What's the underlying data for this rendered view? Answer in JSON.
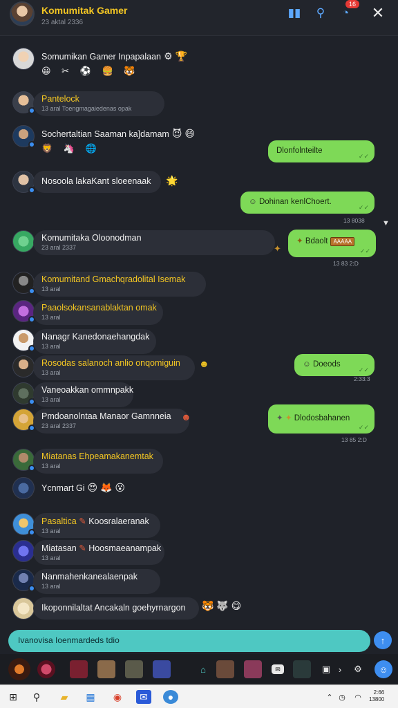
{
  "header": {
    "title": "Komumitak Gamer",
    "subtitle": "23 aktal 2336",
    "badge": "16"
  },
  "icons": {
    "layout": "▮▮",
    "search": "⚲",
    "history": "◔",
    "close": "✕"
  },
  "chats": [
    {
      "name": "Somumikan Gamer Inpapalaan",
      "emoji": "⚙ 🏆",
      "stickers": "😀 ✂ ⚽ 🍔 🐯"
    },
    {
      "name": "Pantelock",
      "meta": "13 aral Toengmagaiedenas opak"
    },
    {
      "name": "Sochertaltian Saaman ka]damam",
      "emoji": "😈 😄",
      "stickers": "🦁 🦄 🌐"
    },
    {
      "name": "Nosoola lakaKant sloeenaak",
      "emoji": "🌟"
    },
    {
      "name": "Komumitaka Oloonodman",
      "meta": "23 aral 2337"
    },
    {
      "name": "Komumitand Gmachqradolital Isemak",
      "meta": "13 aral"
    },
    {
      "name": "Paaolsokansanablaktan omak",
      "meta": "13 aral"
    },
    {
      "name": "Nanagr Kanedonaehangdak",
      "meta": "13 aral"
    },
    {
      "name": "Rosodas salanoch anlio onqomiguin",
      "meta": "13 aral",
      "emoji": "☻"
    },
    {
      "name": "Vaneoakkan ommnpakk",
      "meta": "13 aral"
    },
    {
      "name": "Pmdoanolntaa Manaor Gamnneia",
      "meta": "23 aral 2337",
      "emoji": "☻"
    },
    {
      "name": "Miatanas Ehpeamakanemtak",
      "meta": "13 aral"
    },
    {
      "name": "Ycnmart Gi",
      "emoji": "😍 🦊 😮"
    },
    {
      "name": "Pasaltica",
      "extra": "Koosralaeranak",
      "meta": "13 aral"
    },
    {
      "name": "Miatasan",
      "extra": "Hoosmaeanampak",
      "meta": "13 aral"
    },
    {
      "name": "Nanmahenkanealaenpak",
      "meta": "13 aral"
    },
    {
      "name": "Ikoponnilaltat Ancakaln goehyrnargon",
      "emoji": "🐯 🐺 😋"
    }
  ],
  "outgoing": [
    {
      "text": "Dlonfolnteilte",
      "stamp": ""
    },
    {
      "text": "Dohinan kenlChoert.",
      "stamp": "13 8038"
    },
    {
      "text": "Bdaolt",
      "tag": "AAAAA",
      "stamp": "13 83 2:D"
    },
    {
      "text": "Doeods",
      "stamp": "2:33:3"
    },
    {
      "text": "Dlodosbahanen",
      "stamp": "13 85 2:D"
    }
  ],
  "composer": {
    "placeholder": "Ivanovisa Ioenmardeds tdio"
  },
  "clock": {
    "line1": "2:66",
    "line2": "13800"
  }
}
